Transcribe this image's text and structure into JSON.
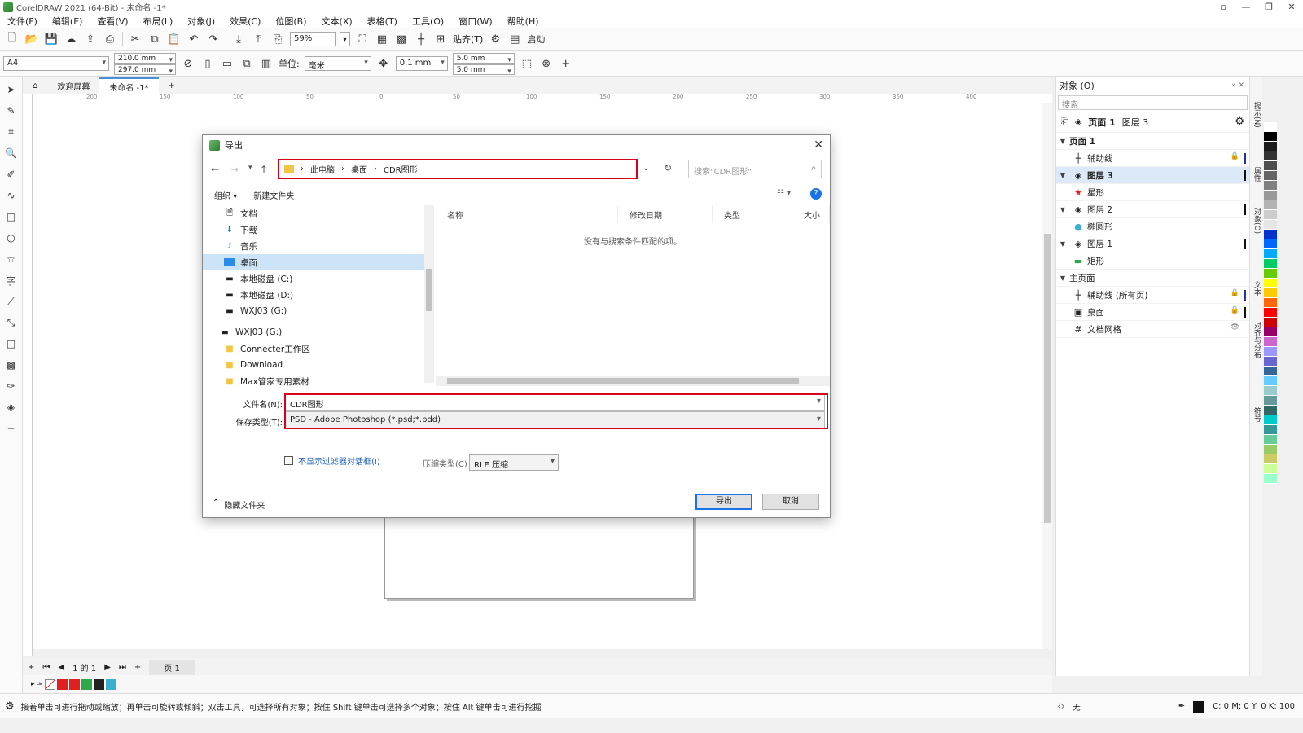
{
  "window": {
    "title": "CorelDRAW 2021 (64-Bit) - 未命名 -1*"
  },
  "menu": [
    "文件(F)",
    "编辑(E)",
    "查看(V)",
    "布局(L)",
    "对象(J)",
    "效果(C)",
    "位图(B)",
    "文本(X)",
    "表格(T)",
    "工具(O)",
    "窗口(W)",
    "帮助(H)"
  ],
  "toolbar": {
    "zoom": "59%",
    "snap_label": "贴齐(T)",
    "launch_label": "启动"
  },
  "propbar": {
    "page_size": "A4",
    "width": "210.0 mm",
    "height": "297.0 mm",
    "units_label": "单位:",
    "units_value": "毫米",
    "nudge": "0.1 mm",
    "dup_x": "5.0 mm",
    "dup_y": "5.0 mm"
  },
  "doc_tabs": {
    "welcome": "欢迎屏幕",
    "doc": "未命名 -1*"
  },
  "ruler": {
    "h_ticks": [
      "200",
      "150",
      "100",
      "50",
      "0",
      "50",
      "100",
      "150",
      "200",
      "250",
      "300",
      "350",
      "400"
    ]
  },
  "pagenav": {
    "counter": "1 的 1",
    "page_tab": "页 1"
  },
  "statusbar": {
    "hint": "接着单击可进行拖动或缩放；再单击可旋转或倾斜；双击工具，可选择所有对象；按住 Shift 键单击可选择多个对象；按住 Alt 键单击可进行挖掘",
    "fill_none": "无",
    "cmyk": "C: 0 M: 0 Y: 0 K: 100"
  },
  "objects_panel": {
    "title": "对象 (O)",
    "search_placeholder": "搜索",
    "crumb_page": "页面 1",
    "crumb_layer": "图层 3",
    "rows": [
      {
        "label": "页面 1"
      },
      {
        "label": "辅助线"
      },
      {
        "label": "图层 3"
      },
      {
        "label": "星形"
      },
      {
        "label": "图层 2"
      },
      {
        "label": "椭圆形"
      },
      {
        "label": "图层 1"
      },
      {
        "label": "矩形"
      },
      {
        "label": "主页面"
      },
      {
        "label": "辅助线 (所有页)"
      },
      {
        "label": "桌面"
      },
      {
        "label": "文档网格"
      }
    ]
  },
  "docker_tabs": [
    "提示(N)",
    "属性",
    "对象(O)",
    "文本",
    "对齐与分布",
    "符号"
  ],
  "dialog": {
    "title": "导出",
    "breadcrumb": [
      "此电脑",
      "桌面",
      "CDR图形"
    ],
    "search_placeholder": "搜索\"CDR图形\"",
    "organize": "组织 ▾",
    "new_folder": "新建文件夹",
    "nav_items": [
      {
        "label": "文档",
        "icon": "document-icon"
      },
      {
        "label": "下载",
        "icon": "download-icon"
      },
      {
        "label": "音乐",
        "icon": "music-icon"
      },
      {
        "label": "桌面",
        "icon": "desktop-icon"
      },
      {
        "label": "本地磁盘 (C:)",
        "icon": "drive-icon"
      },
      {
        "label": "本地磁盘 (D:)",
        "icon": "drive-icon"
      },
      {
        "label": "WXJ03 (G:)",
        "icon": "drive-icon"
      },
      {
        "label": "WXJ03 (G:)",
        "icon": "drive-icon"
      },
      {
        "label": "Connecter工作区",
        "icon": "folder-icon"
      },
      {
        "label": "Download",
        "icon": "folder-icon"
      },
      {
        "label": "Max管家专用素材",
        "icon": "folder-icon"
      }
    ],
    "columns": [
      "名称",
      "修改日期",
      "类型",
      "大小"
    ],
    "empty_message": "没有与搜索条件匹配的项。",
    "filename_label": "文件名(N):",
    "filename_value": "CDR图形",
    "filetype_label": "保存类型(T):",
    "filetype_value": "PSD - Adobe Photoshop (*.psd;*.pdd)",
    "no_filter_label": "不显示过滤器对话框(I)",
    "compression_label": "压缩类型(C)",
    "compression_value": "RLE 压缩",
    "hide_folders": "隐藏文件夹",
    "export_button": "导出",
    "cancel_button": "取消"
  },
  "colors": {
    "highlight_red": "#d9001b",
    "accent_blue": "#1a73e8",
    "palette": [
      "#ffffff",
      "#000000",
      "#1a1a1a",
      "#333333",
      "#4d4d4d",
      "#666666",
      "#808080",
      "#999999",
      "#b3b3b3",
      "#cccccc",
      "#e6e6e6",
      "#0033cc",
      "#0066ff",
      "#00aaff",
      "#00cc66",
      "#66cc00",
      "#ffff00",
      "#ffcc00",
      "#ff6600",
      "#ff0000",
      "#cc0000",
      "#990066",
      "#cc66cc",
      "#9999ff",
      "#6666cc",
      "#336699",
      "#66ccff",
      "#99cccc",
      "#669999",
      "#336666",
      "#00cccc",
      "#339999",
      "#66cc99",
      "#99cc66",
      "#cccc66",
      "#ccff99",
      "#99ffcc"
    ],
    "doc_palette": [
      "#ffffff",
      "#e02020",
      "#e02020",
      "#2ea84a",
      "#222222",
      "#3ab0d0"
    ]
  }
}
